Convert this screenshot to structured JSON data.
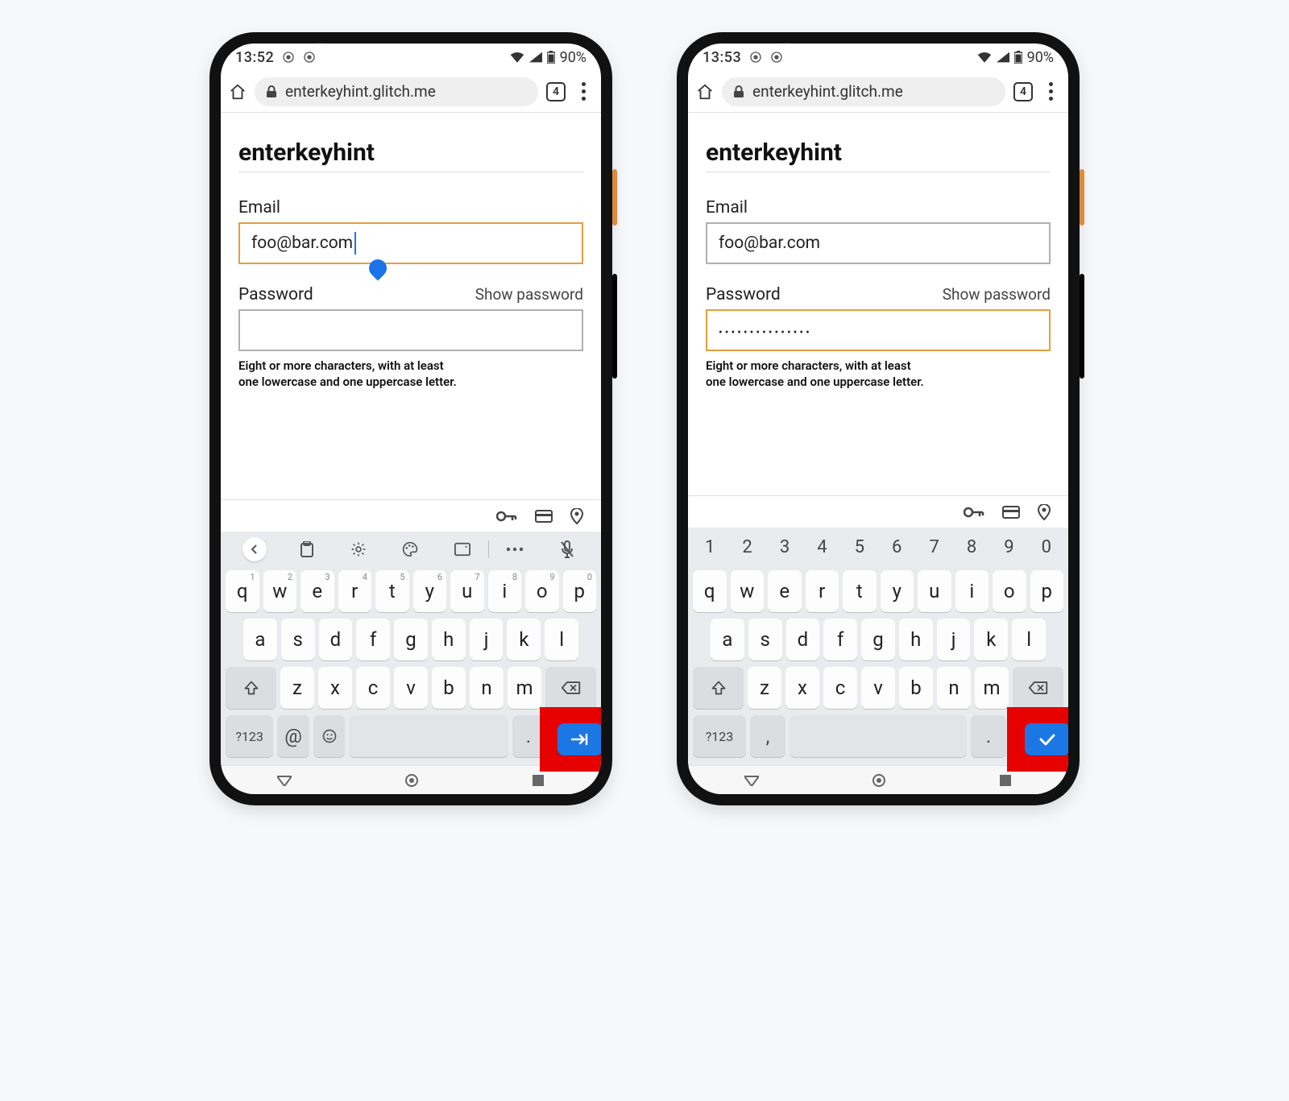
{
  "statusbar": {
    "time_left": "13:52",
    "time_right": "13:53",
    "battery_label": "90%"
  },
  "browser": {
    "url": "enterkeyhint.glitch.me",
    "tab_count": "4"
  },
  "page": {
    "title": "enterkeyhint",
    "email_label": "Email",
    "email_value": "foo@bar.com",
    "password_label": "Password",
    "show_password": "Show password",
    "password_left_value": "",
    "password_right_value": "•••••••••••••••",
    "password_hint_l1": "Eight or more characters, with at least",
    "password_hint_l2": "one lowercase and one uppercase letter."
  },
  "keyboard": {
    "numrow": [
      "1",
      "2",
      "3",
      "4",
      "5",
      "6",
      "7",
      "8",
      "9",
      "0"
    ],
    "row1": [
      "q",
      "w",
      "e",
      "r",
      "t",
      "y",
      "u",
      "i",
      "o",
      "p"
    ],
    "row1_sup": [
      "1",
      "2",
      "3",
      "4",
      "5",
      "6",
      "7",
      "8",
      "9",
      "0"
    ],
    "row2": [
      "a",
      "s",
      "d",
      "f",
      "g",
      "h",
      "j",
      "k",
      "l"
    ],
    "row3": [
      "z",
      "x",
      "c",
      "v",
      "b",
      "n",
      "m"
    ],
    "qmark": "?123",
    "at": "@",
    "comma": ",",
    "dot": "."
  }
}
